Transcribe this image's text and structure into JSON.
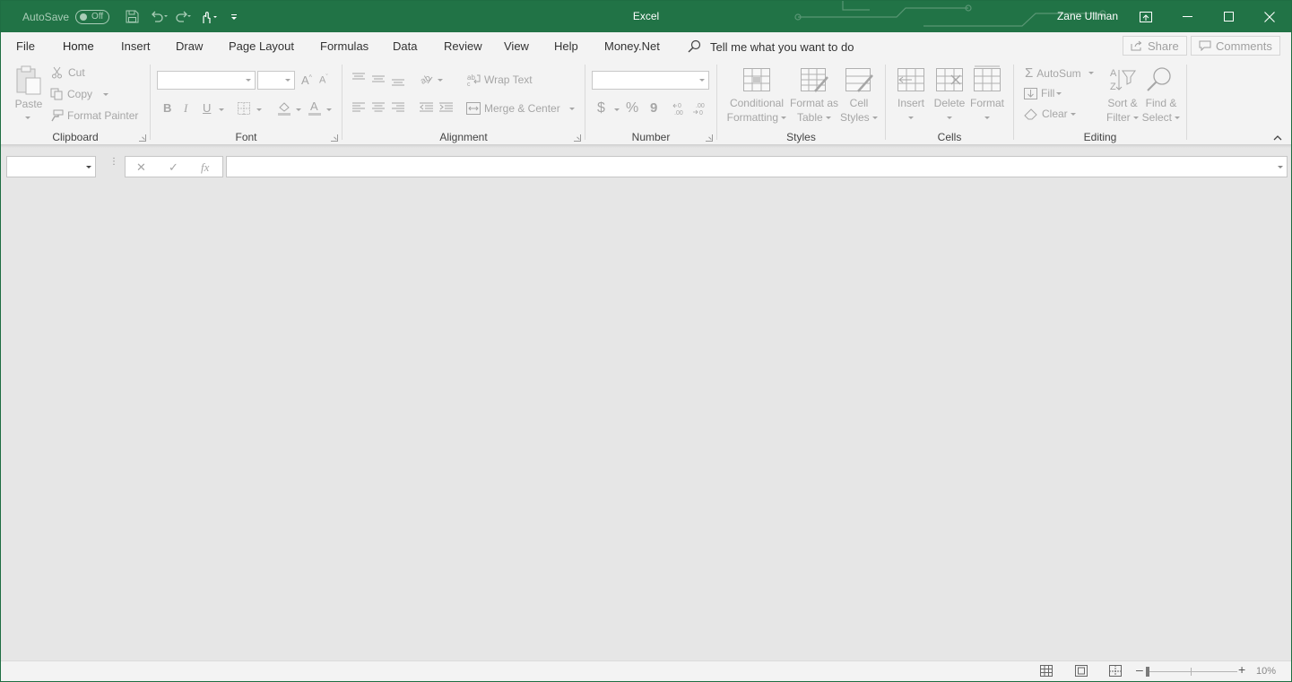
{
  "window": {
    "app_title": "Excel",
    "user_name": "Zane Ullman"
  },
  "quick_access": {
    "autosave_label": "AutoSave",
    "autosave_state": "Off"
  },
  "tabs": [
    {
      "label": "File"
    },
    {
      "label": "Home",
      "active": true
    },
    {
      "label": "Insert"
    },
    {
      "label": "Draw"
    },
    {
      "label": "Page Layout"
    },
    {
      "label": "Formulas"
    },
    {
      "label": "Data"
    },
    {
      "label": "Review"
    },
    {
      "label": "View"
    },
    {
      "label": "Help"
    },
    {
      "label": "Money.Net"
    }
  ],
  "tell_me": "Tell me what you want to do",
  "share_label": "Share",
  "comments_label": "Comments",
  "ribbon": {
    "clipboard": {
      "label": "Clipboard",
      "paste": "Paste",
      "cut": "Cut",
      "copy": "Copy",
      "format_painter": "Format Painter"
    },
    "font": {
      "label": "Font",
      "bold": "B",
      "italic": "I",
      "underline": "U"
    },
    "alignment": {
      "label": "Alignment",
      "wrap_text": "Wrap Text",
      "merge_center": "Merge & Center"
    },
    "number": {
      "label": "Number",
      "currency": "$",
      "percent": "%",
      "comma": "9"
    },
    "styles": {
      "label": "Styles",
      "conditional_1": "Conditional",
      "conditional_2": "Formatting",
      "format_table_1": "Format as",
      "format_table_2": "Table",
      "cell_styles_1": "Cell",
      "cell_styles_2": "Styles"
    },
    "cells": {
      "label": "Cells",
      "insert": "Insert",
      "delete": "Delete",
      "format": "Format"
    },
    "editing": {
      "label": "Editing",
      "autosum": "AutoSum",
      "fill": "Fill",
      "clear": "Clear",
      "sort_1": "Sort &",
      "sort_2": "Filter",
      "find_1": "Find &",
      "find_2": "Select"
    }
  },
  "formula_bar": {
    "fx": "fx"
  },
  "status": {
    "zoom": "10%"
  },
  "colors": {
    "brand": "#217346",
    "workspace": "#e6e6e6",
    "ribbon": "#f3f3f3"
  }
}
